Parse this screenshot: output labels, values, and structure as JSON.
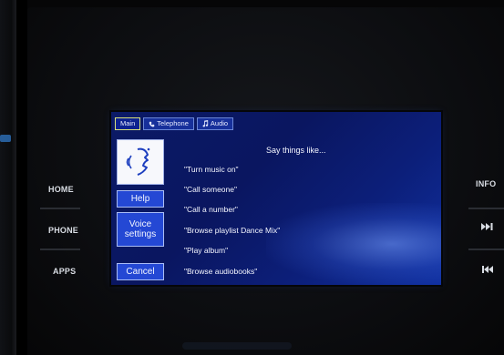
{
  "hardware_left": {
    "home": "HOME",
    "phone": "PHONE",
    "apps": "APPS"
  },
  "hardware_right": {
    "info": "INFO",
    "next_icon": "skip-forward-icon",
    "prev_icon": "skip-back-icon"
  },
  "screen": {
    "tabs": [
      {
        "label": "Main",
        "icon": "",
        "active": true
      },
      {
        "label": "Telephone",
        "icon": "phone-icon",
        "active": false
      },
      {
        "label": "Audio",
        "icon": "music-note-icon",
        "active": false
      }
    ],
    "voice_icon": "voice-speak-icon",
    "buttons": {
      "help": "Help",
      "voice_settings_line1": "Voice",
      "voice_settings_line2": "settings",
      "cancel": "Cancel"
    },
    "hint_title": "Say things like...",
    "hints": [
      "\"Turn music on\"",
      "\"Call someone\"",
      "\"Call a number\"",
      "\"Browse playlist Dance Mix\"",
      "\"Play album\"",
      "\"Browse audiobooks\""
    ]
  },
  "colors": {
    "screen_bg": "#0b1a66",
    "button_bg": "#2448d4",
    "active_tab_border": "#d9e27a"
  }
}
